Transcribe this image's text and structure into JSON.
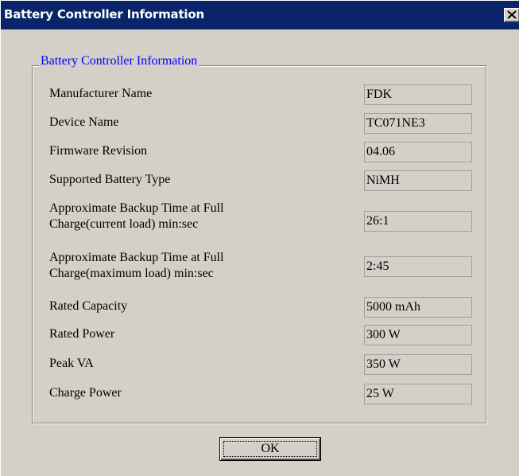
{
  "window": {
    "title": "Battery Controller Information",
    "close_icon": "close-icon"
  },
  "group": {
    "legend": "Battery Controller Information"
  },
  "rows": [
    {
      "label": "Manufacturer Name",
      "value": "FDK"
    },
    {
      "label": "Device Name",
      "value": "TC071NE3"
    },
    {
      "label": "Firmware Revision",
      "value": "04.06"
    },
    {
      "label": "Supported Battery Type",
      "value": "NiMH"
    },
    {
      "label": "Approximate Backup Time at Full Charge(current load) min:sec",
      "value": "26:1"
    },
    {
      "label": "Approximate Backup Time at Full Charge(maximum load) min:sec",
      "value": "2:45"
    },
    {
      "label": "Rated Capacity",
      "value": "5000 mAh"
    },
    {
      "label": "Rated Power",
      "value": "300 W"
    },
    {
      "label": "Peak VA",
      "value": "350 W"
    },
    {
      "label": "Charge Power",
      "value": "25 W"
    }
  ],
  "buttons": {
    "ok_label": "OK"
  },
  "colors": {
    "titlebar": "#0a246a",
    "dialog_background": "#d4d0c8",
    "legend_text": "#0000ff"
  }
}
